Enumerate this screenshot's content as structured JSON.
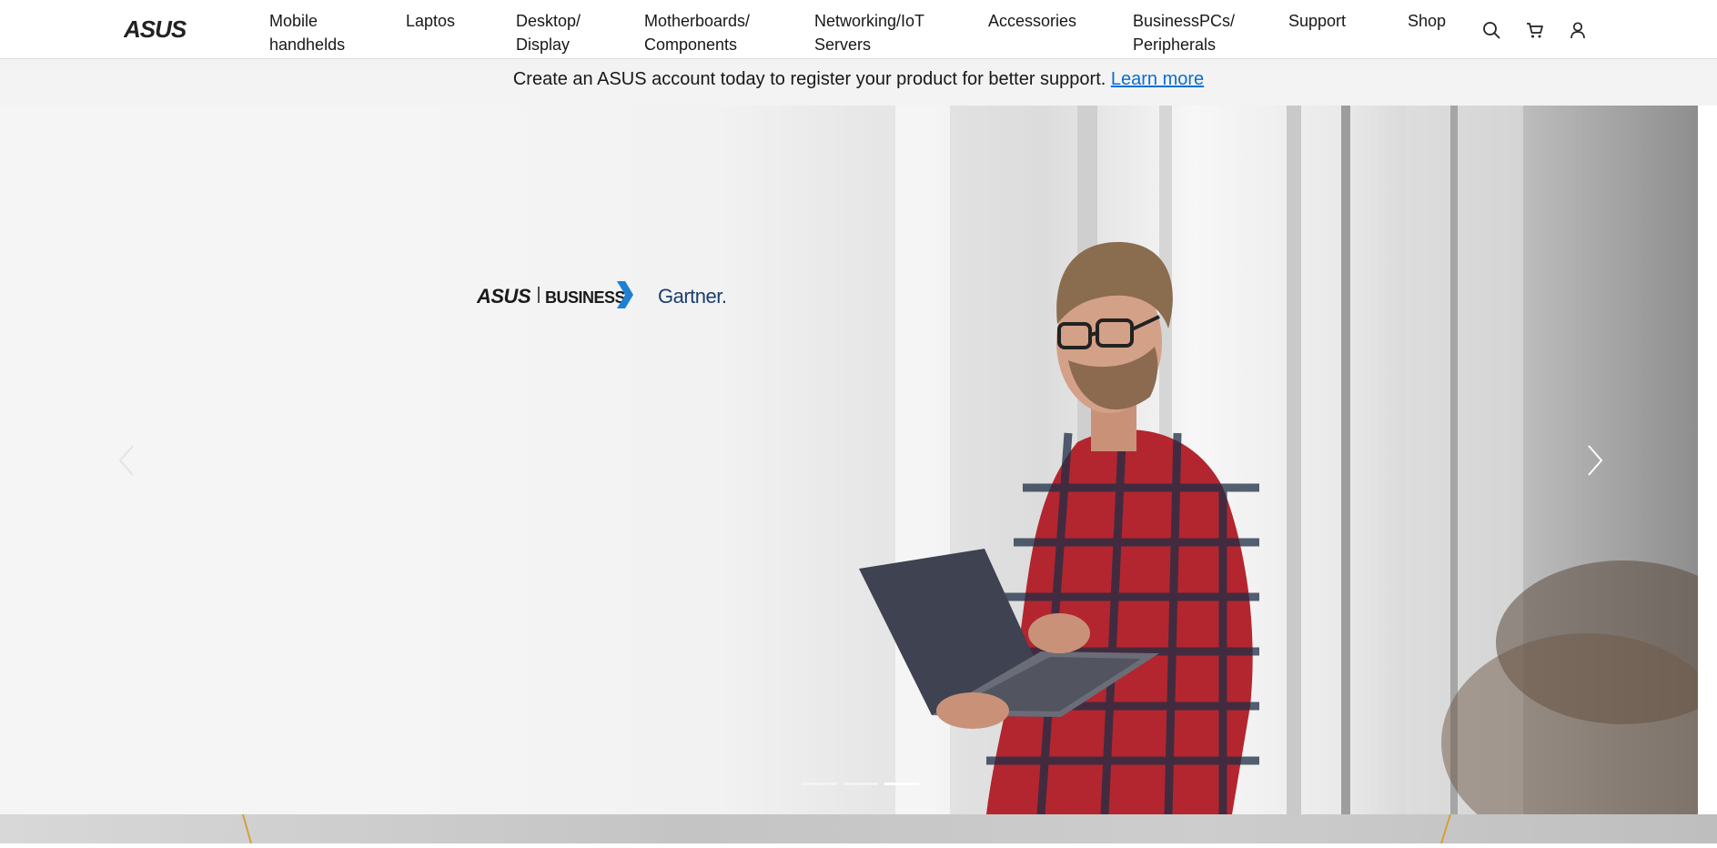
{
  "header": {
    "logo_text": "ASUS",
    "nav": [
      {
        "label": "Mobile\nhandhelds"
      },
      {
        "label": "Laptos"
      },
      {
        "label": "Desktop/\nDisplay"
      },
      {
        "label": "Motherboards/\nComponents"
      },
      {
        "label": "Networking/IoT\nServers"
      },
      {
        "label": "Accessories"
      },
      {
        "label": "BusinessPCs/\nPeripherals"
      },
      {
        "label": "Support"
      },
      {
        "label": "Shop"
      }
    ],
    "icons": [
      "search-icon",
      "cart-icon",
      "account-icon"
    ]
  },
  "notice": {
    "text": "Create an ASUS account today to register your product for better support. ",
    "link": "Learn more"
  },
  "hero": {
    "brand_asus": "ASUS",
    "brand_business": "BUSINESS",
    "brand_partner": "Gartner.",
    "carousel": {
      "slides": 3,
      "active": 3
    },
    "colors": {
      "accent_blue": "#1f7fd4",
      "shirt_red": "#b3262f"
    }
  }
}
